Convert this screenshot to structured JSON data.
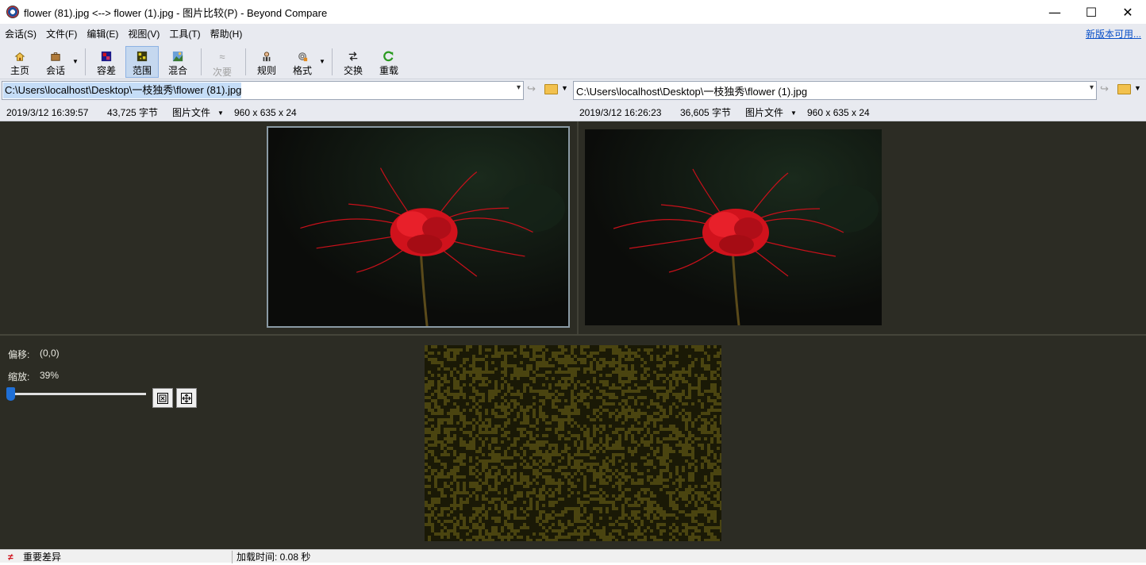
{
  "window": {
    "title": "flower (81).jpg <--> flower (1).jpg - 图片比较(P) - Beyond Compare",
    "minimize": "—",
    "maximize": "☐",
    "close": "✕"
  },
  "menu": {
    "items": [
      "会话(S)",
      "文件(F)",
      "编辑(E)",
      "视图(V)",
      "工具(T)",
      "帮助(H)"
    ],
    "new_version": "新版本可用..."
  },
  "toolbar": {
    "home": "主页",
    "session": "会话",
    "tolerance": "容差",
    "range": "范围",
    "blend": "混合",
    "minor": "次要",
    "rules": "规则",
    "format": "格式",
    "swap": "交换",
    "reload": "重载",
    "active_mode": "范围"
  },
  "left": {
    "path": "C:\\Users\\localhost\\Desktop\\一枝独秀\\flower (81).jpg",
    "timestamp": "2019/3/12 16:39:57",
    "size": "43,725 字节",
    "type": "图片文件",
    "dims": "960 x 635 x 24"
  },
  "right": {
    "path": "C:\\Users\\localhost\\Desktop\\一枝独秀\\flower (1).jpg",
    "timestamp": "2019/3/12 16:26:23",
    "size": "36,605 字节",
    "type": "图片文件",
    "dims": "960 x 635 x 24"
  },
  "diff_panel": {
    "offset_label": "偏移:",
    "offset_value": "(0,0)",
    "zoom_label": "缩放:",
    "zoom_value": "39%",
    "zoom_level": 0.39
  },
  "status": {
    "diff_label": "重要差异",
    "load_time": "加载时间: 0.08 秒"
  },
  "colors": {
    "canvas_bg": "#2c2c24",
    "diff_noise": "#4a4410",
    "accent": "#1f6fd6",
    "flower": "#d0121c"
  }
}
